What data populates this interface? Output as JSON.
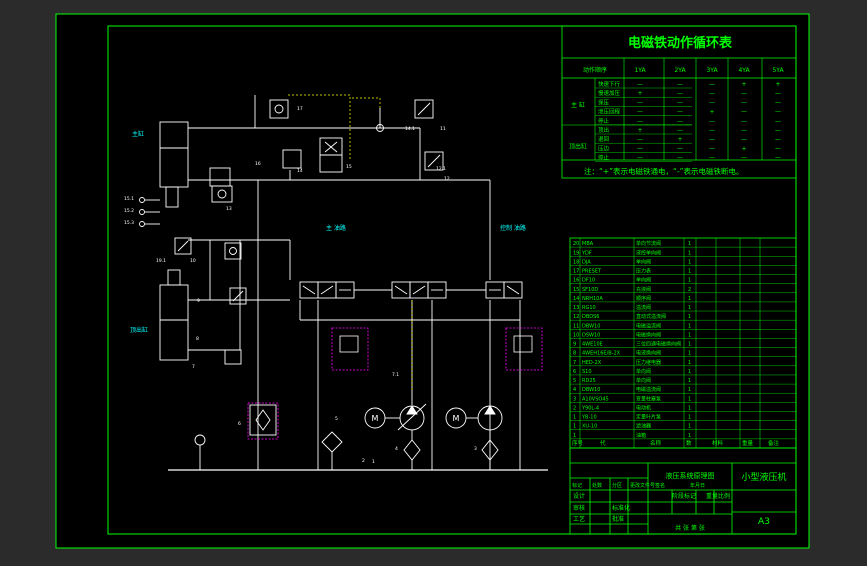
{
  "colors": {
    "outer_background": "#2b2b2b",
    "sheet": "#000000",
    "frame": "#00ff00",
    "lines": "#ffffff",
    "labels": "#00ffff",
    "pilot_lines": "#ffff00",
    "valve_box": "#ff00ff",
    "table_text": "#00ff00"
  },
  "cycle_table": {
    "title": "电磁铁动作循环表",
    "header_action": "动作顺序",
    "columns": [
      "1YA",
      "2YA",
      "3YA",
      "4YA",
      "5YA"
    ],
    "groups": [
      {
        "name": "主 缸",
        "rows": [
          {
            "label": "快速下行",
            "cells": [
              "—",
              "—",
              "—",
              "+",
              "+"
            ]
          },
          {
            "label": "慢速加压",
            "cells": [
              "+",
              "—",
              "—",
              "—",
              "—"
            ]
          },
          {
            "label": "保压",
            "cells": [
              "—",
              "—",
              "—",
              "—",
              "—"
            ]
          },
          {
            "label": "泄压回程",
            "cells": [
              "—",
              "—",
              "+",
              "—",
              "—"
            ]
          },
          {
            "label": "停止",
            "cells": [
              "—",
              "—",
              "—",
              "—",
              "—"
            ]
          }
        ]
      },
      {
        "name": "顶出缸",
        "rows": [
          {
            "label": "顶出",
            "cells": [
              "+",
              "—",
              "—",
              "—",
              "—"
            ]
          },
          {
            "label": "退回",
            "cells": [
              "—",
              "+",
              "—",
              "—",
              "—"
            ]
          },
          {
            "label": "压边",
            "cells": [
              "—",
              "—",
              "—",
              "+",
              "—"
            ]
          },
          {
            "label": "停止",
            "cells": [
              "—",
              "—",
              "—",
              "—",
              "—"
            ]
          }
        ]
      }
    ],
    "note": "注：“+”表示电磁铁通电，“-”表示电磁铁断电。"
  },
  "circuit": {
    "main_cylinder_label": "主缸",
    "ejector_cylinder_label": "顶出缸",
    "main_circuit_label": "主 油路",
    "control_circuit_label": "控制 油路",
    "component_ids": [
      "17",
      "16",
      "15",
      "14",
      "13",
      "12",
      "11",
      "10",
      "9",
      "8",
      "7",
      "6",
      "5",
      "4",
      "3",
      "2",
      "1",
      "15.1",
      "15.2",
      "15.3",
      "12.1",
      "14.1",
      "19.1",
      "7.1"
    ]
  },
  "parts_list": {
    "rows": [
      {
        "no": "20",
        "code": "MBA",
        "name": "单向节流阀",
        "qty": "1"
      },
      {
        "no": "19",
        "code": "YDF",
        "name": "液控单向阀",
        "qty": "1"
      },
      {
        "no": "18",
        "code": "DJA",
        "name": "单向阀",
        "qty": "1"
      },
      {
        "no": "17",
        "code": "PRESET",
        "name": "压力表",
        "qty": "1"
      },
      {
        "no": "16",
        "code": "DF10",
        "name": "单向阀",
        "qty": "1"
      },
      {
        "no": "15",
        "code": "SF10D",
        "name": "充液阀",
        "qty": "2"
      },
      {
        "no": "14",
        "code": "NRH10A",
        "name": "顺序阀",
        "qty": "1"
      },
      {
        "no": "13",
        "code": "RG10",
        "name": "溢流阀",
        "qty": "1"
      },
      {
        "no": "12",
        "code": "DBDS6",
        "name": "直动式溢流阀",
        "qty": "1"
      },
      {
        "no": "11",
        "code": "DBW10",
        "name": "电磁溢流阀",
        "qty": "1"
      },
      {
        "no": "10",
        "code": "DSW10",
        "name": "电磁换向阀",
        "qty": "1"
      },
      {
        "no": "9",
        "code": "4WE10E",
        "name": "三位四通电磁换向阀",
        "qty": "1"
      },
      {
        "no": "8",
        "code": "4WEH16E/B-2X",
        "name": "电液换向阀",
        "qty": "1"
      },
      {
        "no": "7",
        "code": "HED-2X",
        "name": "压力继电器",
        "qty": "1"
      },
      {
        "no": "6",
        "code": "S10",
        "name": "单向阀",
        "qty": "1"
      },
      {
        "no": "5",
        "code": "RD25",
        "name": "单向阀",
        "qty": "1"
      },
      {
        "no": "4",
        "code": "DBW10",
        "name": "电磁溢流阀",
        "qty": "1"
      },
      {
        "no": "3",
        "code": "A10VSO45",
        "name": "变量柱塞泵",
        "qty": "1"
      },
      {
        "no": "2",
        "code": "Y90L-4",
        "name": "电动机",
        "qty": "1"
      },
      {
        "no": "1",
        "code": "YB-10",
        "name": "定量叶片泵",
        "qty": "1"
      },
      {
        "no": "1",
        "code": "XU-10",
        "name": "滤油器",
        "qty": "1"
      },
      {
        "no": "1",
        "code": "",
        "name": "油箱",
        "qty": "1"
      }
    ],
    "header": {
      "no": "序号",
      "code": "代",
      "name": "名称",
      "qty": "数",
      "material": "材料",
      "weight": "重量",
      "remark": "备注"
    }
  },
  "title_block": {
    "drawing_name": "液压系统原理图",
    "project": "小型液压机",
    "scale_label": "比例",
    "sheet_size": "A3",
    "stage_label": "阶段标记",
    "weight_label": "重量",
    "rows_left": [
      "标记",
      "处数",
      "分区",
      "更改文件号",
      "签名",
      "年月日"
    ],
    "design_label": "设计",
    "standard_label": "标准化",
    "check_label": "审核",
    "process_label": "工艺",
    "approve_label": "批准",
    "sheet_count": "共 张 第 张"
  }
}
